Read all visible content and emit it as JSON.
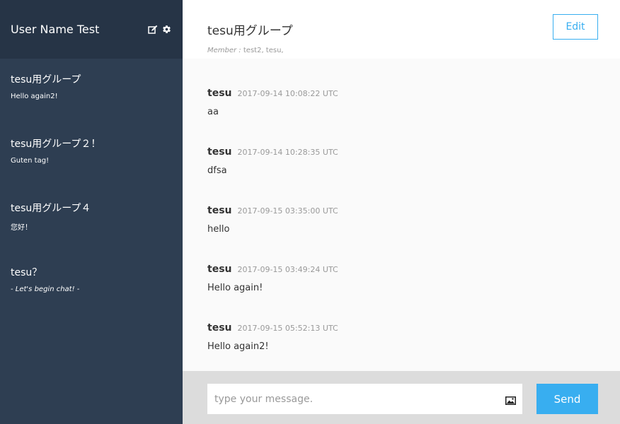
{
  "sidebar": {
    "user_name": "User Name Test",
    "icons": [
      "edit-icon",
      "gear-icon"
    ],
    "groups": [
      {
        "name": "tesu用グループ",
        "last_message": "Hello again2!"
      },
      {
        "name": "tesu用グループ２！",
        "last_message": "Guten tag!"
      },
      {
        "name": "tesu用グループ４",
        "last_message": "您好！"
      },
      {
        "name": "tesu？",
        "last_message": "- Let's begin chat! -"
      }
    ]
  },
  "header": {
    "title": "tesu用グループ",
    "members_label": "Member :",
    "members": "test2, tesu,",
    "edit_label": "Edit"
  },
  "messages": [
    {
      "user": "tesu",
      "time": "2017-09-14 10:08:22 UTC",
      "text": "aa"
    },
    {
      "user": "tesu",
      "time": "2017-09-14 10:28:35 UTC",
      "text": "dfsa"
    },
    {
      "user": "tesu",
      "time": "2017-09-15 03:35:00 UTC",
      "text": "hello"
    },
    {
      "user": "tesu",
      "time": "2017-09-15 03:49:24 UTC",
      "text": "Hello again!"
    },
    {
      "user": "tesu",
      "time": "2017-09-15 05:52:13 UTC",
      "text": "Hello again2!"
    }
  ],
  "form": {
    "placeholder": "type your message.",
    "value": "",
    "image_icon": "image-icon",
    "send_label": "Send"
  },
  "colors": {
    "sidebar_bg": "#2e3e52",
    "sidebar_header_bg": "#263446",
    "accent": "#38aef0",
    "form_bg": "#dcdcdc"
  }
}
